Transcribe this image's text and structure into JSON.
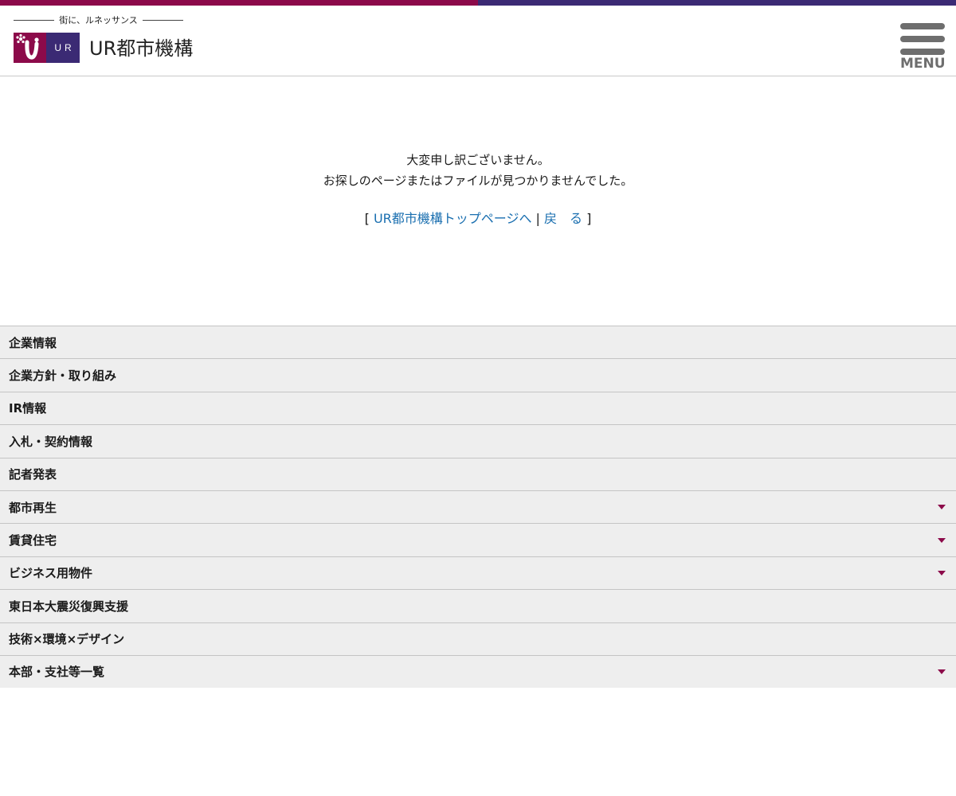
{
  "header": {
    "tagline": "街に、ルネッサンス",
    "logo_mark_text": "UR",
    "logo_text": "UR都市機構",
    "menu_label": "MENU"
  },
  "main": {
    "message_line1": "大変申し訳ございません。",
    "message_line2": "お探しのページまたはファイルが見つかりませんでした。",
    "bracket_open": "[ ",
    "top_link": "UR都市機構トップページへ",
    "separator": " | ",
    "back_link": "戻　る",
    "bracket_close": " ]"
  },
  "nav": {
    "items": [
      {
        "label": "企業情報",
        "has_arrow": false
      },
      {
        "label": "企業方針・取り組み",
        "has_arrow": false
      },
      {
        "label": "IR情報",
        "has_arrow": false
      },
      {
        "label": "入札・契約情報",
        "has_arrow": false
      },
      {
        "label": "記者発表",
        "has_arrow": false
      },
      {
        "label": "都市再生",
        "has_arrow": true
      },
      {
        "label": "賃貸住宅",
        "has_arrow": true
      },
      {
        "label": "ビジネス用物件",
        "has_arrow": true
      },
      {
        "label": "東日本大震災復興支援",
        "has_arrow": false
      },
      {
        "label": "技術×環境×デザイン",
        "has_arrow": false
      },
      {
        "label": "本部・支社等一覧",
        "has_arrow": true
      }
    ]
  },
  "colors": {
    "brand_magenta": "#8c0a4a",
    "brand_purple": "#3b2a74",
    "link_blue": "#1a6fb0",
    "nav_bg": "#eeeeee"
  },
  "icons": {
    "menu": "hamburger-icon",
    "dropdown": "triangle-down-icon"
  }
}
